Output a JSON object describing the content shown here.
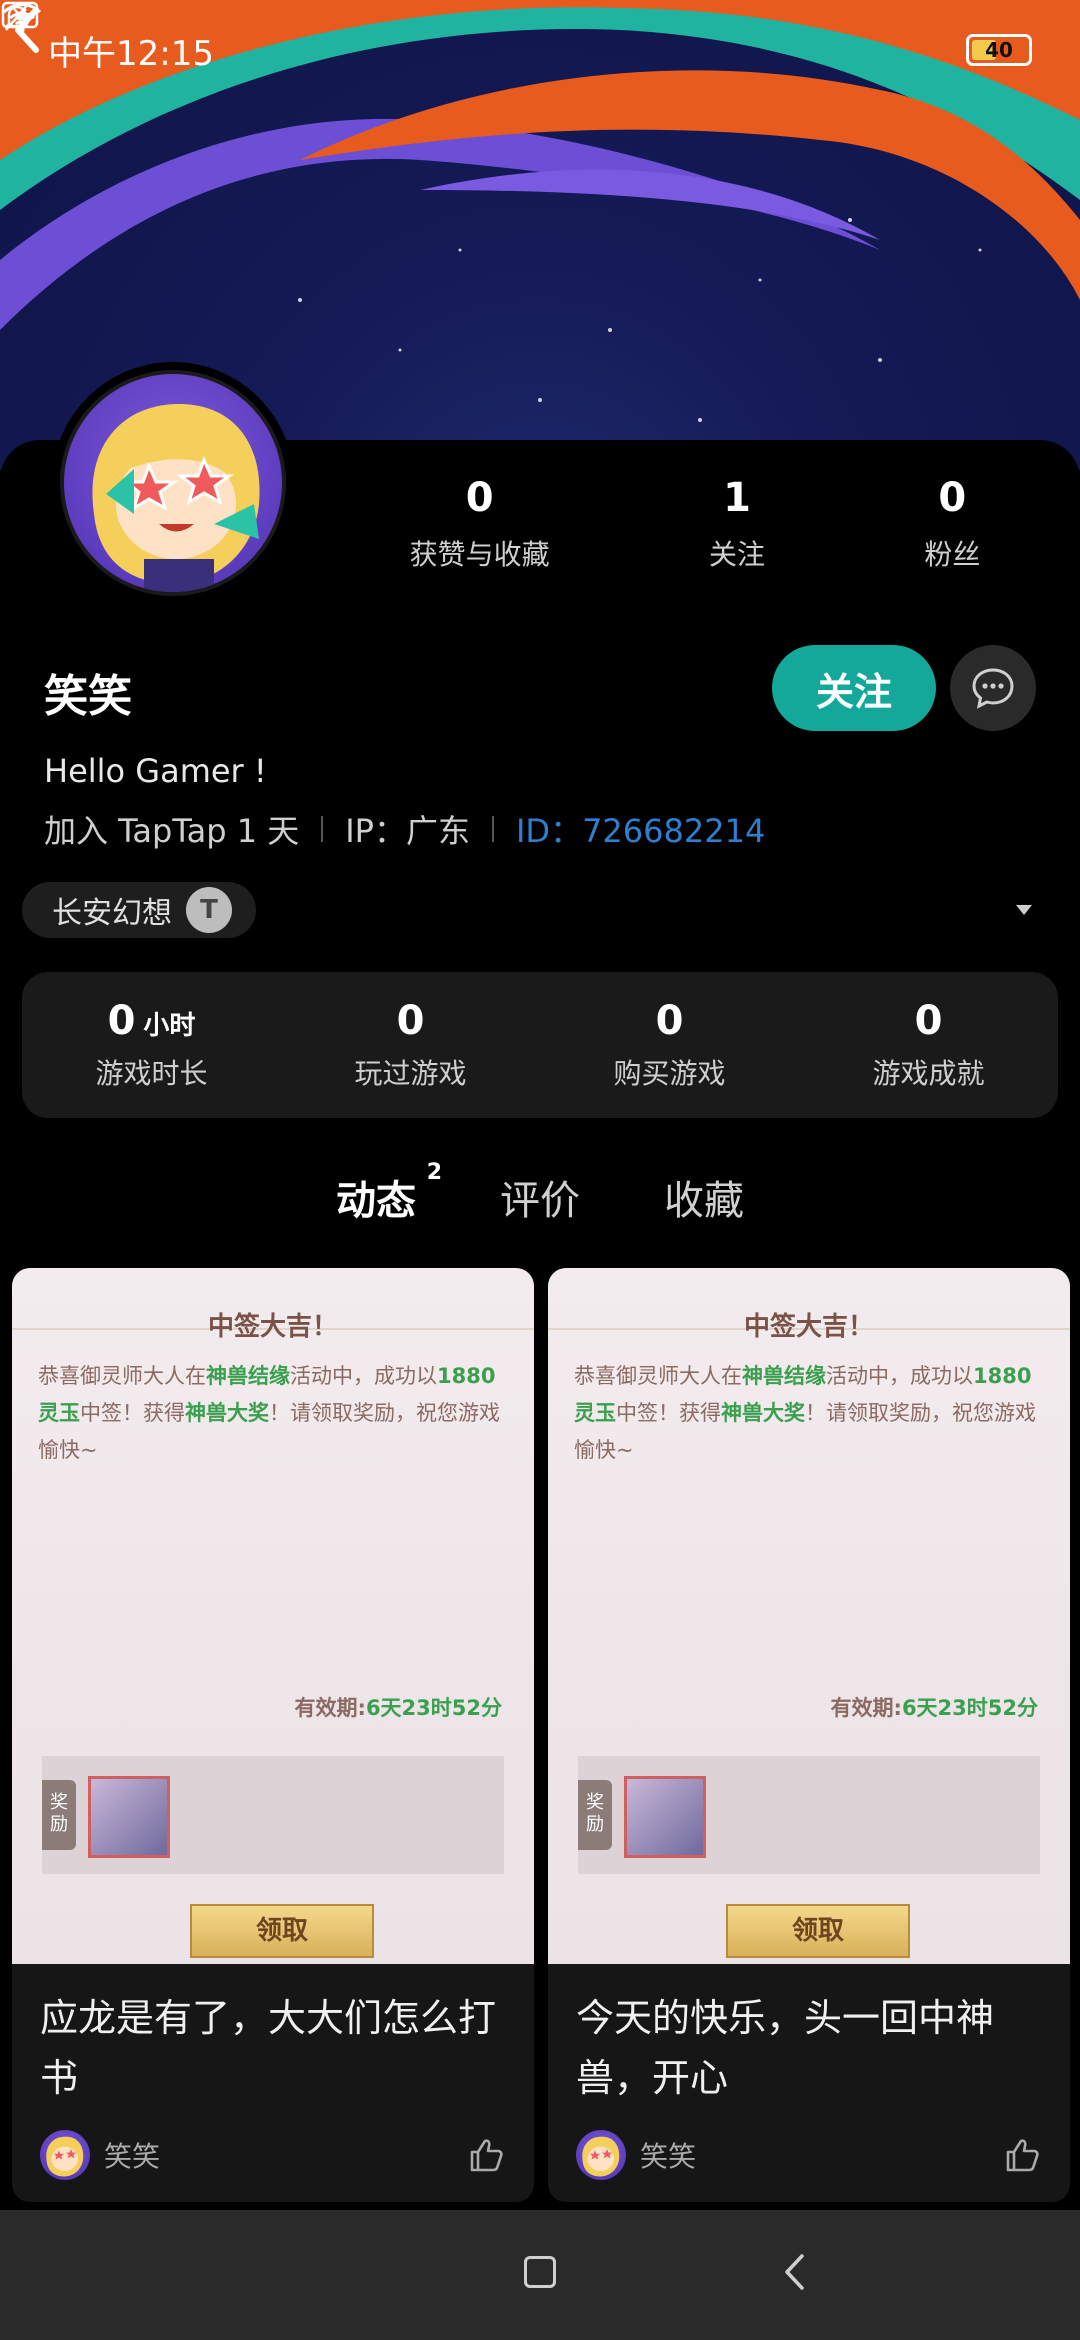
{
  "status_bar": {
    "time": "中午12:15",
    "battery": "40"
  },
  "profile": {
    "name": "笑笑",
    "follow_label": "关注",
    "bio": "Hello Gamer !",
    "joined": "加入 TapTap 1 天",
    "ip": "IP：广东",
    "user_id": "ID：726682214",
    "stats": [
      {
        "num": "0",
        "label": "获赞与收藏"
      },
      {
        "num": "1",
        "label": "关注"
      },
      {
        "num": "0",
        "label": "粉丝"
      }
    ]
  },
  "game_chip": {
    "name": "长安幻想",
    "icon_letter": "T"
  },
  "game_stats": {
    "playtime_num": "0",
    "playtime_unit": "小时",
    "playtime_label": "游戏时长",
    "played_num": "0",
    "played_label": "玩过游戏",
    "bought_num": "0",
    "bought_label": "购买游戏",
    "achieve_num": "0",
    "achieve_label": "游戏成就"
  },
  "tabs": {
    "feed": "动态",
    "feed_count": "2",
    "reviews": "评价",
    "favorites": "收藏"
  },
  "cards": [
    {
      "img_title": "中签大吉！",
      "img_text_1": "恭喜御灵师大人在",
      "img_event": "神兽结缘",
      "img_text_2": "活动中，成功以",
      "img_amount": "1880灵玉",
      "img_text_3": "中签！获得",
      "img_prize": "神兽大奖",
      "img_text_4": "！请领取奖励，祝您游戏愉快~",
      "valid_label": "有效期:",
      "valid_value": "6天23时52分",
      "reward_tag": "奖励",
      "claim_label": "领取",
      "title": "应龙是有了，大大们怎么打书",
      "author": "笑笑"
    },
    {
      "img_title": "中签大吉！",
      "img_text_1": "恭喜御灵师大人在",
      "img_event": "神兽结缘",
      "img_text_2": "活动中，成功以",
      "img_amount": "1880灵玉",
      "img_text_3": "中签！获得",
      "img_prize": "神兽大奖",
      "img_text_4": "！请领取奖励，祝您游戏愉快~",
      "valid_label": "有效期:",
      "valid_value": "6天23时52分",
      "reward_tag": "奖励",
      "claim_label": "领取",
      "title": "今天的快乐，头一回中神兽，开心",
      "author": "笑笑"
    }
  ],
  "colors": {
    "accent": "#14a89a",
    "link": "#2f7fcf",
    "background": "#000000"
  }
}
